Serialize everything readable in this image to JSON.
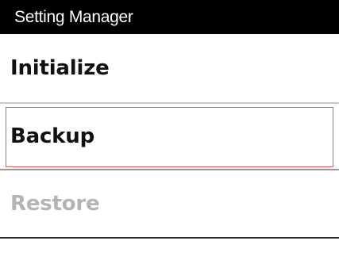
{
  "window": {
    "title": "Setting Manager"
  },
  "menu": {
    "items": [
      {
        "label": "Initialize",
        "state": "enabled"
      },
      {
        "label": "Backup",
        "state": "focused"
      },
      {
        "label": "Restore",
        "state": "disabled"
      }
    ]
  },
  "colors": {
    "title_bar_bg": "#000000",
    "title_text": "#ffffff",
    "item_text": "#111111",
    "disabled_text": "#b4b4b4",
    "focus_ring": "#e05a5a"
  }
}
